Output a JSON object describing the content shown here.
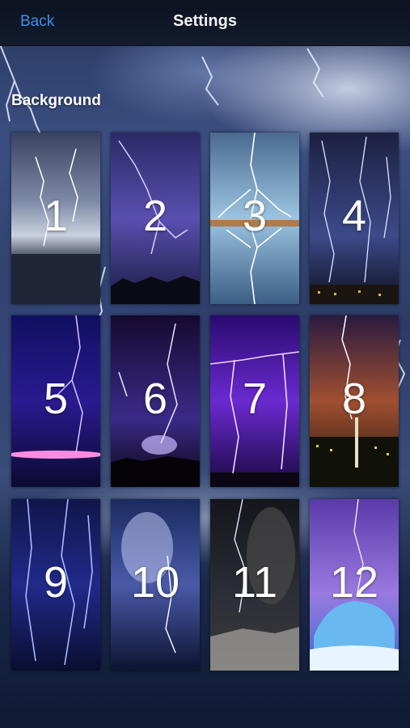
{
  "nav": {
    "back_label": "Back",
    "title": "Settings"
  },
  "section": {
    "label": "Background"
  },
  "tiles": [
    {
      "number": "1"
    },
    {
      "number": "2"
    },
    {
      "number": "3"
    },
    {
      "number": "4"
    },
    {
      "number": "5"
    },
    {
      "number": "6"
    },
    {
      "number": "7"
    },
    {
      "number": "8"
    },
    {
      "number": "9"
    },
    {
      "number": "10"
    },
    {
      "number": "11"
    },
    {
      "number": "12"
    }
  ]
}
